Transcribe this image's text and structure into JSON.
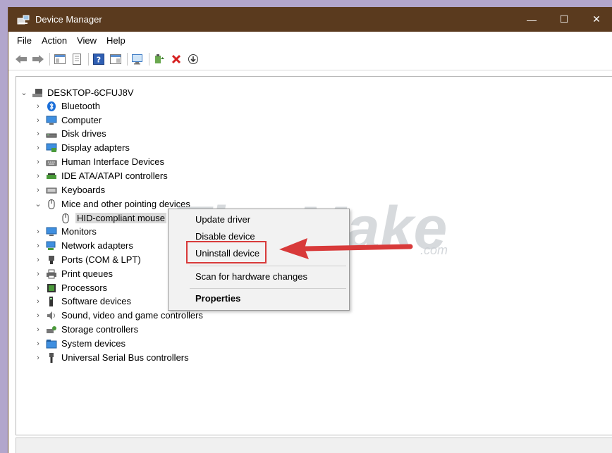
{
  "window": {
    "title": "Device Manager"
  },
  "menu": {
    "items": [
      "File",
      "Action",
      "View",
      "Help"
    ]
  },
  "tree": {
    "root": "DESKTOP-6CFUJ8V",
    "categories": [
      "Bluetooth",
      "Computer",
      "Disk drives",
      "Display adapters",
      "Human Interface Devices",
      "IDE ATA/ATAPI controllers",
      "Keyboards",
      "Mice and other pointing devices",
      "Monitors",
      "Network adapters",
      "Ports (COM & LPT)",
      "Print queues",
      "Processors",
      "Software devices",
      "Sound, video and game controllers",
      "Storage controllers",
      "System devices",
      "Universal Serial Bus controllers"
    ],
    "expanded_child": "HID-compliant mouse"
  },
  "context_menu": {
    "update": "Update driver",
    "disable": "Disable device",
    "uninstall": "Uninstall device",
    "scan": "Scan for hardware changes",
    "properties": "Properties"
  },
  "watermark": {
    "brand": "TipsMake",
    "suffix": ".com"
  },
  "colors": {
    "titlebar": "#5a3a1e",
    "highlight": "#d83a3a"
  }
}
